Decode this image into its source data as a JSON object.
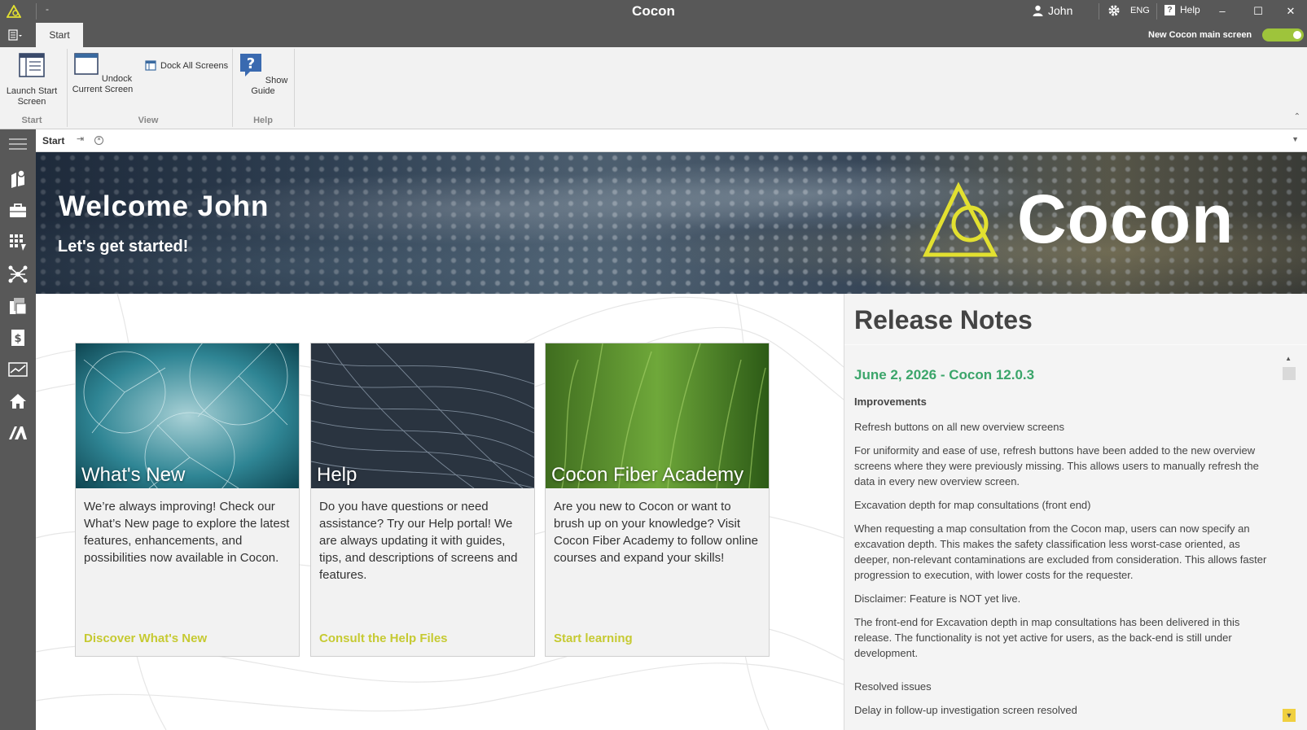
{
  "window": {
    "title": "Cocon",
    "dash": "-",
    "user": "John",
    "language": "ENG",
    "help": "Help",
    "minimize": "–",
    "maximize": "☐",
    "close": "✕"
  },
  "ribbon": {
    "tab": "Start",
    "toggle_label": "New Cocon main screen",
    "toggle_on": true,
    "launch_start": "Launch Start Screen",
    "undock_current": "Undock Current Screen",
    "dock_all": "Dock All Screens",
    "show_guide": "Show Guide",
    "group_start": "Start",
    "group_view": "View",
    "group_help": "Help"
  },
  "doc_tab": {
    "title": "Start",
    "pin": "⇥",
    "close": "×"
  },
  "hero": {
    "welcome": "Welcome John",
    "subtitle": "Let's get started!",
    "brand": "Cocon"
  },
  "cards": [
    {
      "title": "What's New",
      "description": "We’re always improving! Check our What’s New page to explore the latest features, enhancements, and possibilities now available in Cocon.",
      "link": "Discover What's New"
    },
    {
      "title": "Help",
      "description": "Do you have questions or need assistance? Try our Help portal! We are always updating it with guides, tips, and descriptions of screens and features.",
      "link": "Consult the Help Files"
    },
    {
      "title": "Cocon Fiber Academy",
      "description": "Are you new to Cocon or want to brush up on your knowledge? Visit Cocon Fiber Academy to follow online courses and expand your skills!",
      "link": "Start learning"
    }
  ],
  "release_notes": {
    "heading": "Release Notes",
    "release_title": "June 2, 2026 - Cocon 12.0.3",
    "improvements_title": "Improvements",
    "item1_title": "Refresh buttons on all new overview screens",
    "item1_text": "For uniformity and ease of use, refresh buttons have been added to the new overview screens where they were previously missing. This allows users to manually refresh the data in every new overview screen.",
    "item2_title": "Excavation depth for map consultations (front end)",
    "item2_text": "When requesting a map consultation from the Cocon map, users can now specify an excavation depth. This makes the safety classification less worst-case oriented, as deeper, non-relevant contaminations are excluded from consideration. This allows faster progression to execution, with lower costs for the requester.",
    "item2_disclaimer": "Disclaimer: Feature is NOT yet live.",
    "item2_note": "The front-end for Excavation depth in map consultations has been delivered in this release. The functionality is not yet active for users, as the back-end is still under development.",
    "resolved_title": "Resolved issues",
    "resolved1": "Delay in follow-up investigation screen resolved"
  },
  "colors": {
    "chrome": "#585858",
    "accent_green": "#9ec43b",
    "link_yellow": "#c6ca32",
    "release_green": "#3ba56a",
    "logo_yellow": "#e2e030"
  }
}
